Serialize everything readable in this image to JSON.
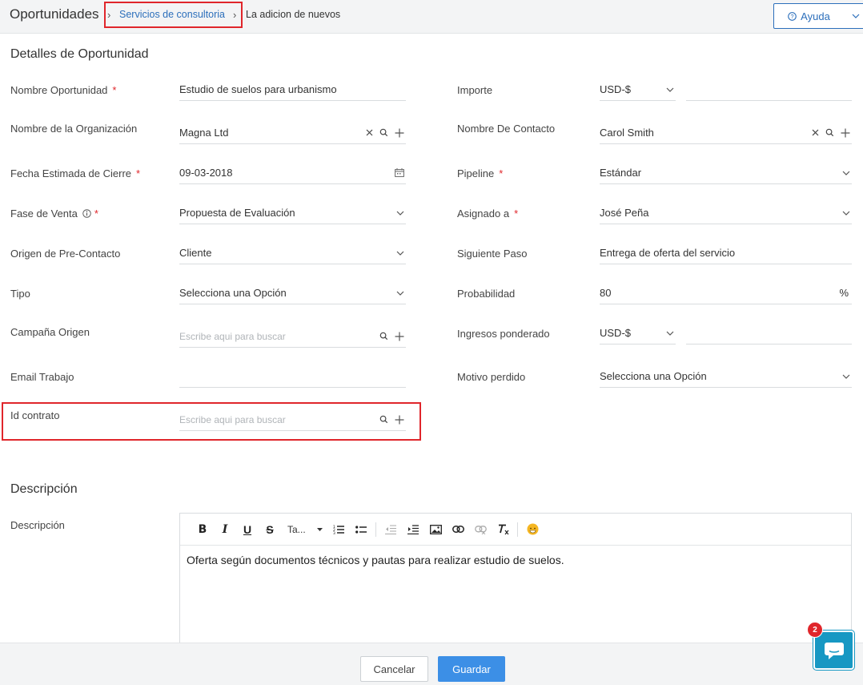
{
  "breadcrumb": {
    "root": "Oportunidades",
    "link": "Servicios de consultoria",
    "current": "La adicion de nuevos"
  },
  "help": {
    "label": "Ayuda"
  },
  "sections": {
    "details": "Detalles de Oportunidad",
    "description": "Descripción"
  },
  "left": {
    "name": {
      "label": "Nombre Oportunidad",
      "required": "*",
      "value": "Estudio de suelos para urbanismo"
    },
    "org": {
      "label": "Nombre de la Organización",
      "value": "Magna Ltd"
    },
    "close_date": {
      "label": "Fecha Estimada de Cierre",
      "required": "*",
      "value": "09-03-2018"
    },
    "stage": {
      "label": "Fase de Venta",
      "required": "*",
      "value": "Propuesta de Evaluación"
    },
    "lead_source": {
      "label": "Origen de Pre-Contacto",
      "value": "Cliente"
    },
    "type": {
      "label": "Tipo",
      "value": "Selecciona una Opción"
    },
    "campaign": {
      "label": "Campaña Origen",
      "placeholder": "Escribe aqui para buscar"
    },
    "email": {
      "label": "Email Trabajo",
      "value": ""
    },
    "contract": {
      "label": "Id contrato",
      "placeholder": "Escribe aqui para buscar"
    }
  },
  "right": {
    "amount": {
      "label": "Importe",
      "currency": "USD-$",
      "value": ""
    },
    "contact": {
      "label": "Nombre De Contacto",
      "value": "Carol Smith"
    },
    "pipeline": {
      "label": "Pipeline",
      "required": "*",
      "value": "Estándar"
    },
    "assigned": {
      "label": "Asignado a",
      "required": "*",
      "value": "José Peña"
    },
    "next_step": {
      "label": "Siguiente Paso",
      "value": "Entrega de oferta del servicio"
    },
    "probability": {
      "label": "Probabilidad",
      "value": "80",
      "unit": "%"
    },
    "weighted": {
      "label": "Ingresos ponderado",
      "currency": "USD-$",
      "value": ""
    },
    "lost_reason": {
      "label": "Motivo perdido",
      "value": "Selecciona una Opción"
    }
  },
  "description": {
    "label": "Descripción",
    "font_label": "Ta...",
    "text": "Oferta según documentos técnicos y pautas para realizar estudio de suelos."
  },
  "footer": {
    "cancel": "Cancelar",
    "save": "Guardar"
  },
  "chat": {
    "badge": "2"
  },
  "colors": {
    "accent": "#2c6fbb",
    "save": "#3c8fe6",
    "highlight": "#e0262b",
    "chat": "#1798c3"
  }
}
